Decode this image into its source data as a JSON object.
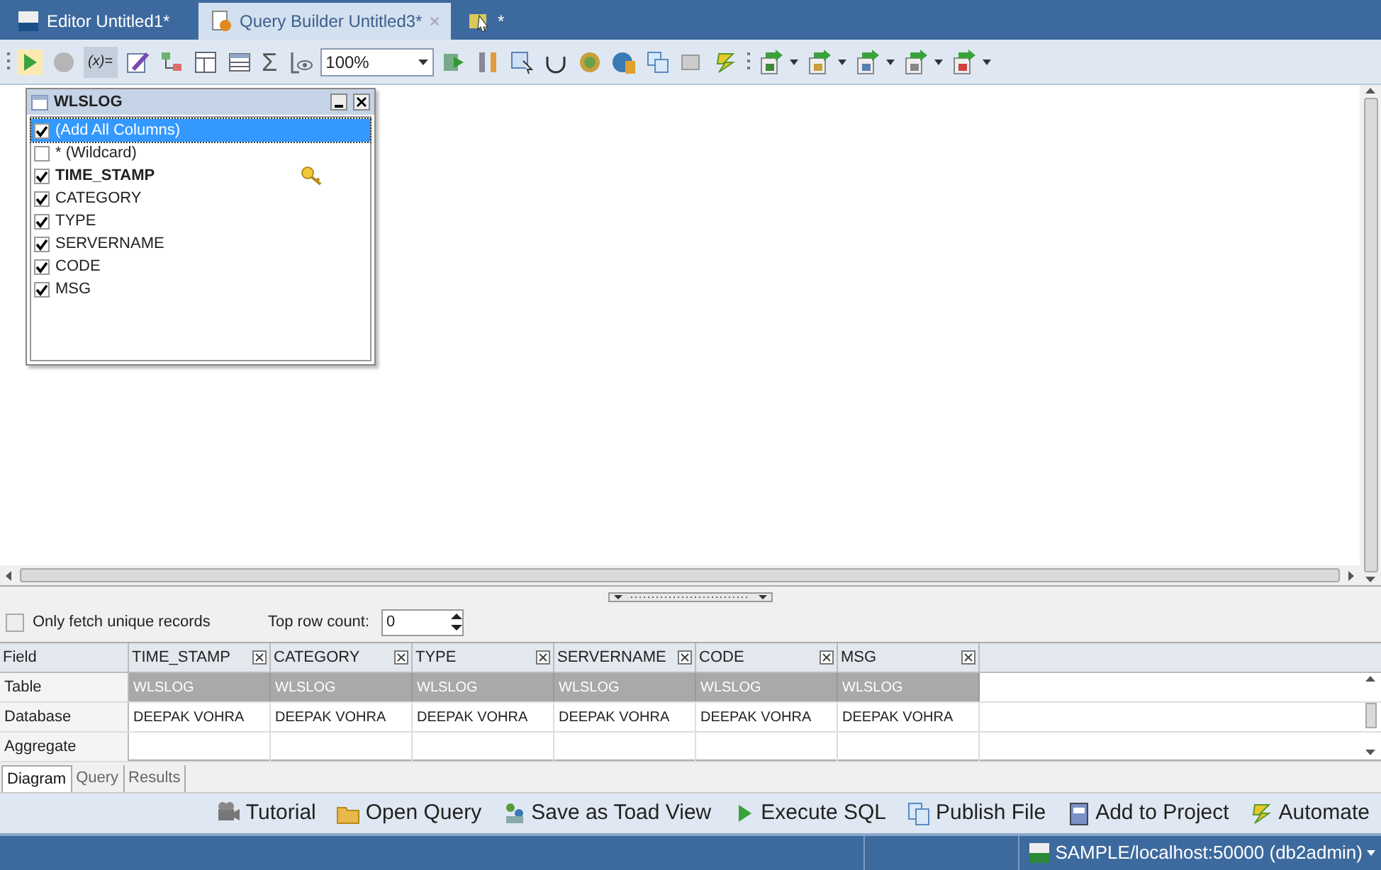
{
  "tabs": [
    {
      "label": "Editor Untitled1*",
      "selected": false,
      "kind": "editor"
    },
    {
      "label": "Query Builder Untitled3*",
      "selected": true,
      "kind": "query"
    },
    {
      "label": "*",
      "selected": false,
      "kind": "wizard"
    }
  ],
  "toolbar": {
    "variable_label": "(x)=",
    "sum_symbol": "Σ",
    "zoom": "100%"
  },
  "table_box": {
    "title": "WLSLOG",
    "items": [
      {
        "label": "(Add All Columns)",
        "checked": true,
        "selected": true,
        "primary_key": false
      },
      {
        "label": "* (Wildcard)",
        "checked": false,
        "selected": false,
        "primary_key": false
      },
      {
        "label": "TIME_STAMP",
        "checked": true,
        "selected": false,
        "primary_key": true
      },
      {
        "label": "CATEGORY",
        "checked": true,
        "selected": false,
        "primary_key": false
      },
      {
        "label": "TYPE",
        "checked": true,
        "selected": false,
        "primary_key": false
      },
      {
        "label": "SERVERNAME",
        "checked": true,
        "selected": false,
        "primary_key": false
      },
      {
        "label": "CODE",
        "checked": true,
        "selected": false,
        "primary_key": false
      },
      {
        "label": "MSG",
        "checked": true,
        "selected": false,
        "primary_key": false
      }
    ]
  },
  "options": {
    "unique_records": {
      "label": "Only fetch unique records",
      "checked": false
    },
    "top_row_count": {
      "label": "Top row count:",
      "value": "0"
    }
  },
  "grid": {
    "columns": [
      "Field",
      "TIME_STAMP",
      "CATEGORY",
      "TYPE",
      "SERVERNAME",
      "CODE",
      "MSG"
    ],
    "rows": [
      {
        "kind": "readonly",
        "cells": [
          "Table",
          "WLSLOG",
          "WLSLOG",
          "WLSLOG",
          "WLSLOG",
          "WLSLOG",
          "WLSLOG"
        ]
      },
      {
        "kind": "editable",
        "cells": [
          "Database",
          "DEEPAK VOHRA",
          "DEEPAK VOHRA",
          "DEEPAK VOHRA",
          "DEEPAK VOHRA",
          "DEEPAK VOHRA",
          "DEEPAK VOHRA"
        ]
      },
      {
        "kind": "editable",
        "cells": [
          "Aggregate"
        ]
      }
    ]
  },
  "bottom_tabs": [
    {
      "label": "Diagram",
      "selected": true
    },
    {
      "label": "Query",
      "selected": false
    },
    {
      "label": "Results",
      "selected": false
    }
  ],
  "actions": [
    "Tutorial",
    "Open Query",
    "Save as Toad View",
    "Execute SQL",
    "Publish File",
    "Add to Project",
    "Automate"
  ],
  "status_bar": {
    "connection": "SAMPLE/localhost:50000 (db2admin)"
  }
}
